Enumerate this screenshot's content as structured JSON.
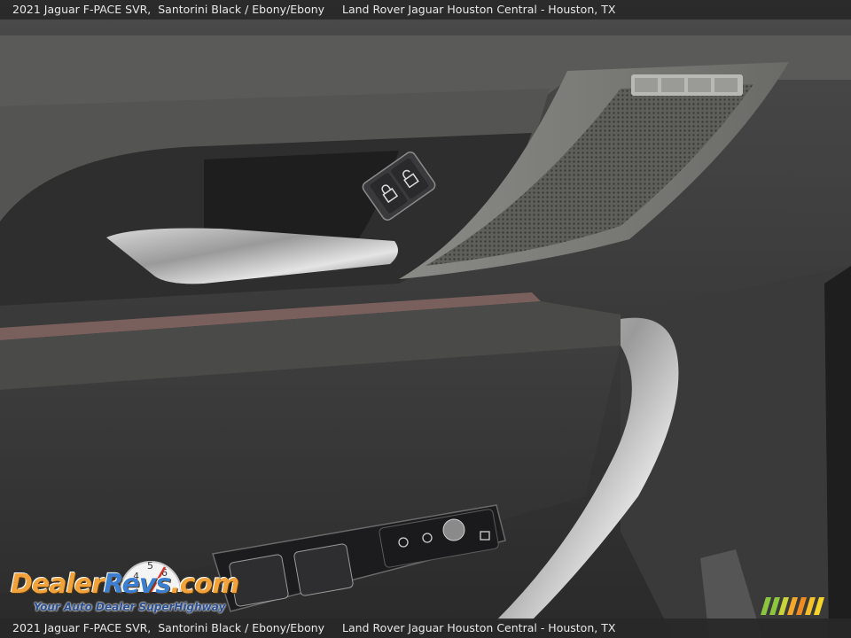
{
  "caption": {
    "vehicle": "2021 Jaguar F-PACE SVR,",
    "color": "Santorini Black / Ebony/Ebony",
    "dealer": "Land Rover Jaguar Houston Central - Houston, TX"
  },
  "logo": {
    "brand_part1": "Dealer",
    "brand_part2": "Revs",
    "brand_suffix": ".com",
    "tagline": "Your Auto Dealer SuperHighway"
  },
  "photo": {
    "subject": "door interior panel",
    "icons": [
      "lock-icon",
      "unlock-icon",
      "speaker-grille",
      "window-switch"
    ]
  }
}
